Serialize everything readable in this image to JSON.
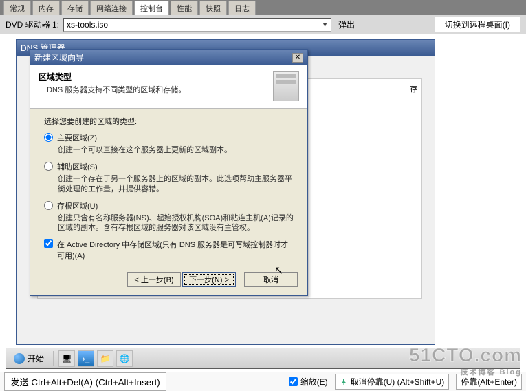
{
  "tabs": [
    "常规",
    "内存",
    "存储",
    "网络连接",
    "控制台",
    "性能",
    "快照",
    "日志"
  ],
  "active_tab_index": 4,
  "dvd": {
    "label": "DVD 驱动器 1:",
    "value": "xs-tools.iso",
    "eject": "弹出",
    "remote": "切换到远程桌面(I)"
  },
  "dns_title": "DNS 管理器",
  "wizard": {
    "title": "新建区域向导",
    "header_title": "区域类型",
    "header_sub": "DNS 服务器支持不同类型的区域和存储。",
    "prompt": "选择您要创建的区域的类型:",
    "options": [
      {
        "label": "主要区域(Z)",
        "desc": "创建一个可以直接在这个服务器上更新的区域副本。",
        "checked": true
      },
      {
        "label": "辅助区域(S)",
        "desc": "创建一个存在于另一个服务器上的区域的副本。此选项帮助主服务器平衡处理的工作量，并提供容错。",
        "checked": false
      },
      {
        "label": "存根区域(U)",
        "desc": "创建只含有名称服务器(NS)、起始授权机构(SOA)和粘连主机(A)记录的区域的副本。含有存根区域的服务器对该区域没有主管权。",
        "checked": false
      }
    ],
    "checkbox_label": "在 Active Directory 中存储区域(只有 DNS 服务器是可写域控制器时才可用)(A)",
    "checkbox_checked": true,
    "buttons": {
      "back": "< 上一步(B)",
      "next": "下一步(N) >",
      "cancel": "取消"
    }
  },
  "taskbar": {
    "start": "开始"
  },
  "hostbar": {
    "cad": "发送 Ctrl+Alt+Del(A) (Ctrl+Alt+Insert)",
    "scale": "缩放(E)",
    "undock": "取消停靠(U) (Alt+Shift+U)",
    "redock": "停靠(Alt+Enter)"
  },
  "watermark": {
    "main": "51CTO.com",
    "sub": "技术博客    Blog"
  }
}
